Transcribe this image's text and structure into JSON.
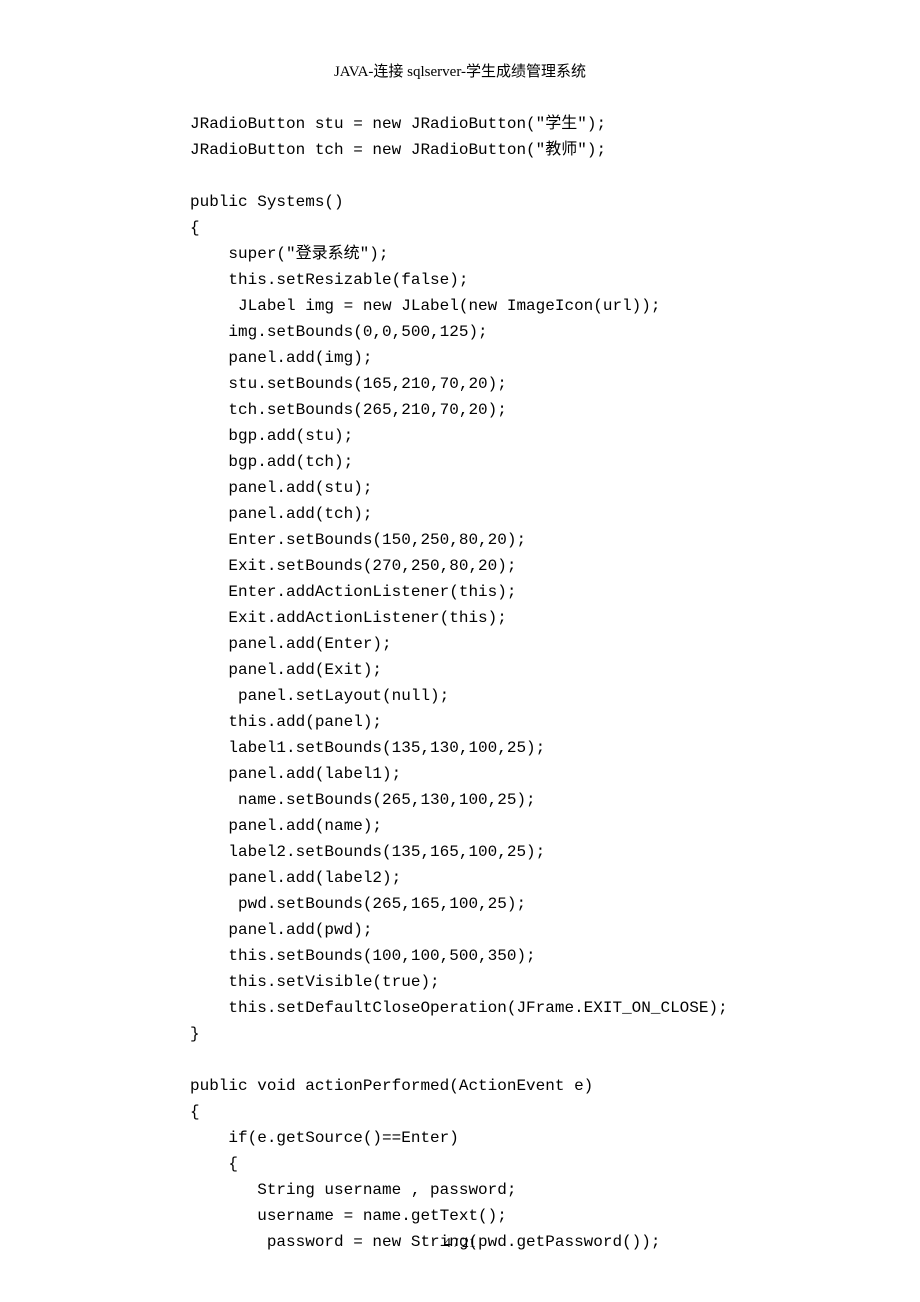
{
  "header": "JAVA-连接 sqlserver-学生成绩管理系统",
  "code": "JRadioButton stu = new JRadioButton(\"学生\");\nJRadioButton tch = new JRadioButton(\"教师\");\n\npublic Systems()\n{\n    super(\"登录系统\");\n    this.setResizable(false);\n     JLabel img = new JLabel(new ImageIcon(url));\n    img.setBounds(0,0,500,125);\n    panel.add(img);\n    stu.setBounds(165,210,70,20);\n    tch.setBounds(265,210,70,20);\n    bgp.add(stu);\n    bgp.add(tch);\n    panel.add(stu);\n    panel.add(tch);\n    Enter.setBounds(150,250,80,20);\n    Exit.setBounds(270,250,80,20);\n    Enter.addActionListener(this);\n    Exit.addActionListener(this);\n    panel.add(Enter);\n    panel.add(Exit);\n     panel.setLayout(null);\n    this.add(panel);\n    label1.setBounds(135,130,100,25);\n    panel.add(label1);\n     name.setBounds(265,130,100,25);\n    panel.add(name);\n    label2.setBounds(135,165,100,25);\n    panel.add(label2);\n     pwd.setBounds(265,165,100,25);\n    panel.add(pwd);\n    this.setBounds(100,100,500,350);\n    this.setVisible(true);\n    this.setDefaultCloseOperation(JFrame.EXIT_ON_CLOSE);\n}\n\npublic void actionPerformed(ActionEvent e)\n{\n    if(e.getSource()==Enter)\n    {\n       String username , password;\n       username = name.getText();\n        password = new String(pwd.getPassword());",
  "pageNumber": "4 / 21"
}
